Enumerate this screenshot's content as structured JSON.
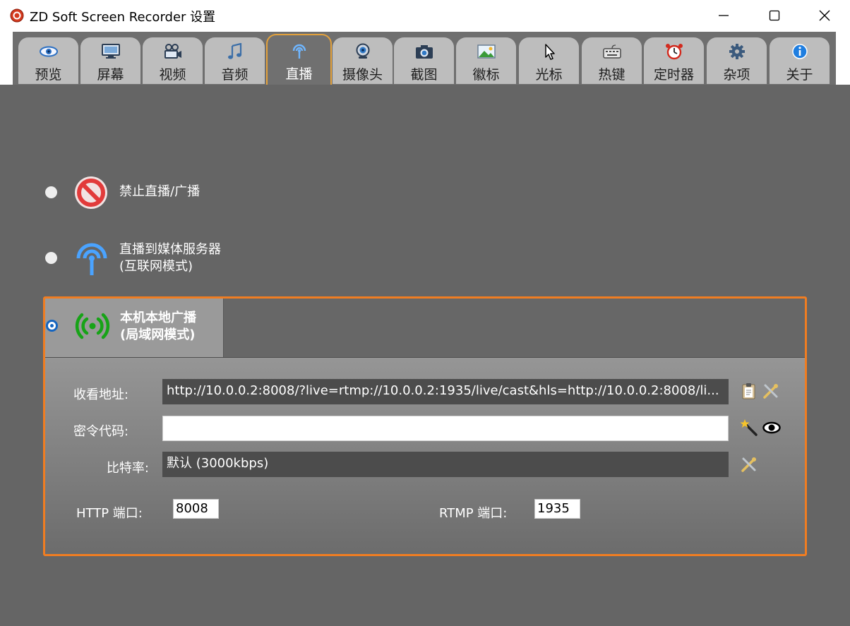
{
  "window": {
    "title": "ZD Soft Screen Recorder 设置"
  },
  "tabs": [
    {
      "label": "预览",
      "icon": "eye-icon"
    },
    {
      "label": "屏幕",
      "icon": "monitor-icon"
    },
    {
      "label": "视频",
      "icon": "video-camera-icon"
    },
    {
      "label": "音频",
      "icon": "music-note-icon"
    },
    {
      "label": "直播",
      "icon": "broadcast-antenna-icon",
      "active": true
    },
    {
      "label": "摄像头",
      "icon": "webcam-icon"
    },
    {
      "label": "截图",
      "icon": "camera-icon"
    },
    {
      "label": "徽标",
      "icon": "picture-icon"
    },
    {
      "label": "光标",
      "icon": "cursor-icon"
    },
    {
      "label": "热键",
      "icon": "keyboard-icon"
    },
    {
      "label": "定时器",
      "icon": "alarm-clock-icon"
    },
    {
      "label": "杂项",
      "icon": "gear-icon"
    },
    {
      "label": "关于",
      "icon": "info-icon"
    }
  ],
  "options": {
    "disable": {
      "label": "禁止直播/广播",
      "selected": false
    },
    "media_server": {
      "line1": "直播到媒体服务器",
      "line2": "(互联网模式)",
      "selected": false
    },
    "local": {
      "line1": "本机本地广播",
      "line2": "(局域网模式)",
      "selected": true
    }
  },
  "local_panel": {
    "watch_url": {
      "label": "收看地址:",
      "value": "http://10.0.0.2:8008/?live=rtmp://10.0.0.2:1935/live/cast&hls=http://10.0.0.2:8008/li..."
    },
    "password": {
      "label": "密令代码:",
      "value": ""
    },
    "bitrate": {
      "label": "比特率:",
      "value": "默认 (3000kbps)"
    },
    "http_port": {
      "label": "HTTP 端口:",
      "value": "8008"
    },
    "rtmp_port": {
      "label": "RTMP 端口:",
      "value": "1935"
    }
  },
  "colors": {
    "accent_orange": "#f07d22",
    "tab_active_border": "#e4a23c",
    "radio_selected": "#1565c0"
  }
}
